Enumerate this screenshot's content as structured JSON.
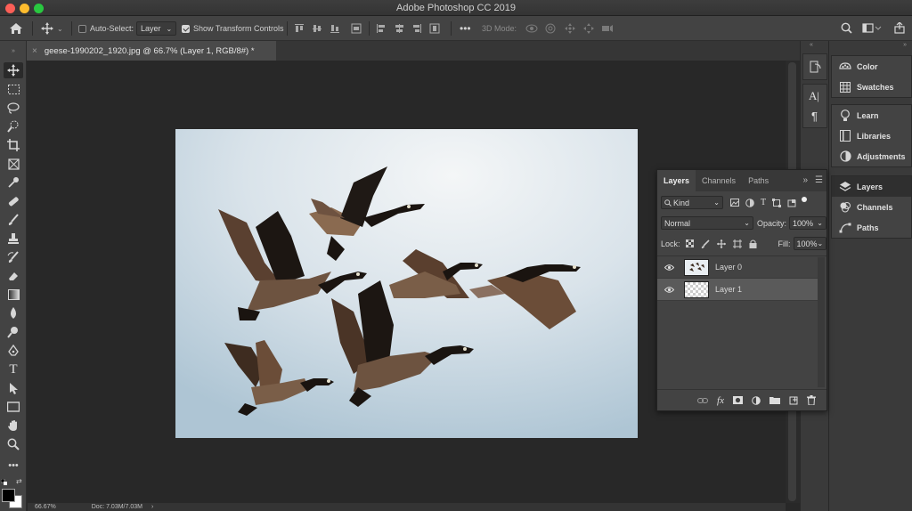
{
  "app": {
    "title": "Adobe Photoshop CC 2019"
  },
  "options_bar": {
    "auto_select_label": "Auto-Select:",
    "auto_select_checked": false,
    "layer_select_value": "Layer",
    "show_transform_label": "Show Transform Controls",
    "show_transform_checked": true,
    "three_d_mode_label": "3D Mode:"
  },
  "document": {
    "tab_title": "geese-1990202_1920.jpg @ 66.7% (Layer 1, RGB/8#) *",
    "zoom": "66.67%",
    "doc_size": "Doc: 7.03M/7.03M"
  },
  "right_panels": {
    "group1": [
      {
        "label": "Color",
        "icon": "color-wheel-icon"
      },
      {
        "label": "Swatches",
        "icon": "swatches-grid-icon"
      }
    ],
    "group2": [
      {
        "label": "Learn",
        "icon": "lightbulb-icon"
      },
      {
        "label": "Libraries",
        "icon": "libraries-icon"
      },
      {
        "label": "Adjustments",
        "icon": "adjustments-icon"
      }
    ],
    "group3": [
      {
        "label": "Layers",
        "icon": "layers-icon"
      },
      {
        "label": "Channels",
        "icon": "channels-icon"
      },
      {
        "label": "Paths",
        "icon": "paths-icon"
      }
    ]
  },
  "layers_panel": {
    "tabs": [
      "Layers",
      "Channels",
      "Paths"
    ],
    "active_tab": "Layers",
    "filter_kind": "Kind",
    "blend_mode": "Normal",
    "opacity_label": "Opacity:",
    "opacity_value": "100%",
    "lock_label": "Lock:",
    "fill_label": "Fill:",
    "fill_value": "100%",
    "layers": [
      {
        "name": "Layer 0",
        "visible": true,
        "selected": false
      },
      {
        "name": "Layer 1",
        "visible": true,
        "selected": true
      }
    ]
  },
  "colors": {
    "foreground": "#000000",
    "background": "#ffffff",
    "ui_dark": "#282828",
    "panel": "#434343"
  }
}
